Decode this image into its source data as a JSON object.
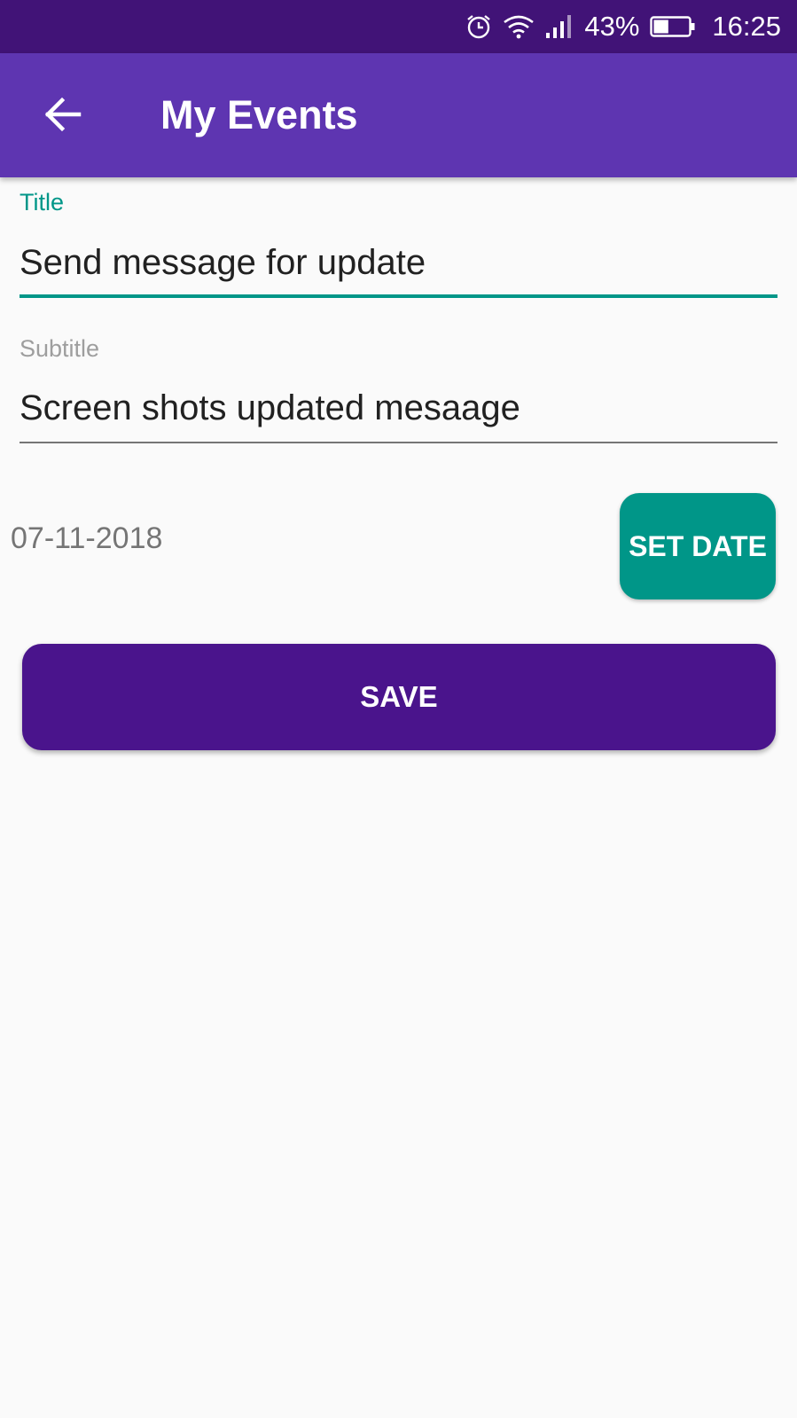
{
  "status_bar": {
    "battery_percent": "43%",
    "time": "16:25",
    "icons": [
      "alarm-icon",
      "wifi-icon",
      "signal-icon",
      "battery-icon"
    ],
    "battery_level": 0.43
  },
  "app_bar": {
    "title": "My Events",
    "back_icon": "arrow-back-icon"
  },
  "form": {
    "title_label": "Title",
    "title_value": "Send message for update",
    "subtitle_label": "Subtitle",
    "subtitle_value": "Screen shots updated mesaage",
    "date_value": "07-11-2018",
    "set_date_label": "SET DATE",
    "save_label": "SAVE"
  },
  "colors": {
    "status_bar": "#411377",
    "app_bar": "#5e35b1",
    "accent": "#009688",
    "save_button": "#4a148c",
    "background": "#fafafa"
  }
}
